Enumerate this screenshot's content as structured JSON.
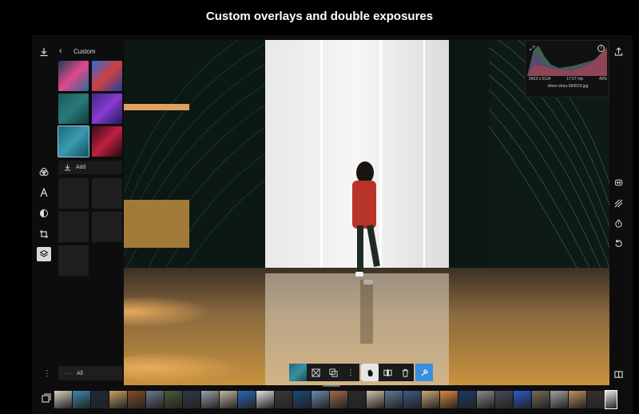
{
  "headline": "Custom overlays and double exposures",
  "left_rail": {
    "icons": [
      "download-icon",
      "circles-icon",
      "text-icon",
      "mask-icon",
      "crop-icon",
      "layers-icon"
    ],
    "active": "layers-icon",
    "more": "⋮"
  },
  "overlay_panel": {
    "title": "Custom",
    "add_label": "Add",
    "all_label": "All",
    "thumbnails": [
      {
        "name": "city-night",
        "colors": [
          "#1a3a5c",
          "#e04a8a",
          "#2a6a9a"
        ]
      },
      {
        "name": "portrait-blue",
        "colors": [
          "#2a6ad8",
          "#d04040",
          "#1a40a0"
        ]
      },
      {
        "name": "teal-texture",
        "colors": [
          "#1a5a5a",
          "#2a7a7a",
          "#0e3a3a"
        ]
      },
      {
        "name": "neon-abstract",
        "colors": [
          "#3a2a8a",
          "#8a3ad0",
          "#1a1a5a"
        ]
      },
      {
        "name": "teal-grain",
        "colors": [
          "#1e6a7e",
          "#3a9ab0",
          "#145060"
        ]
      },
      {
        "name": "red-lights",
        "colors": [
          "#3a0a1a",
          "#c02040",
          "#1a0a10"
        ]
      }
    ],
    "empty_slots": 5
  },
  "histogram": {
    "dimensions": "3423 x 5134",
    "megapixels": "17.57 mp",
    "zoom": "40%",
    "filename": "oliver-sheu-384919.jpg"
  },
  "right_rail": {
    "icons": [
      "export-icon",
      "face-icon",
      "stripes-icon",
      "timer-icon",
      "undo-icon",
      "compare-icon"
    ]
  },
  "toolbar": {
    "buttons": [
      "overlay-thumb",
      "blend-mode-icon",
      "duplicate-icon",
      "more-icon",
      "hand-icon",
      "split-icon",
      "trash-icon",
      "picker-icon"
    ]
  },
  "filmstrip": {
    "current_index": 30,
    "colors": [
      "#d8d0c0",
      "#3a8ab0",
      "#1a2a3a",
      "#c8a060",
      "#8a4a2a",
      "#6a7a8a",
      "#4a5a3a",
      "#2a3a4a",
      "#9aa0a8",
      "#c0b8a0",
      "#2a6ab8",
      "#e0e0e0",
      "#3a3a3a",
      "#1a4a7a",
      "#6a8ab0",
      "#a06a4a",
      "#2a2a2a",
      "#d0c0a8",
      "#5a7a9a",
      "#3a5a8a",
      "#c8a878",
      "#e08a3a",
      "#1a3a6a",
      "#8a8a8a",
      "#4a4a5a",
      "#2a5ad0",
      "#7a6a5a",
      "#a0a0a0",
      "#c09060",
      "#3a3030",
      "#e8e8e8"
    ]
  },
  "accent": "#3b8fe0"
}
